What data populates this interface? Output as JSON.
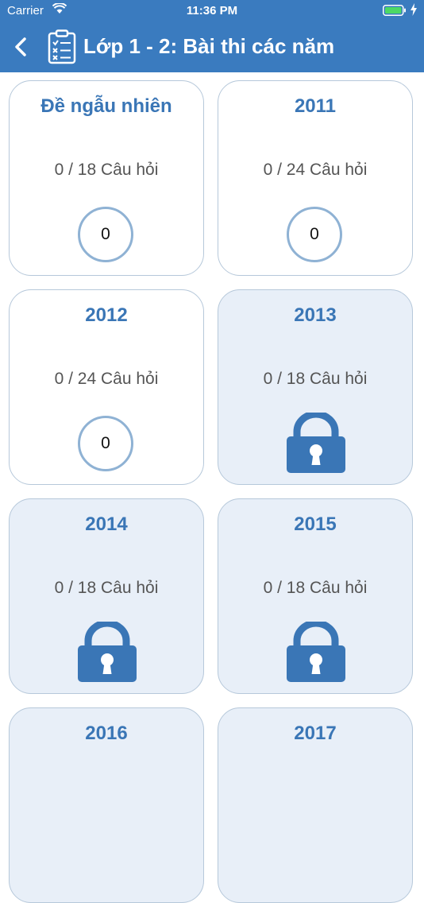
{
  "status_bar": {
    "carrier": "Carrier",
    "time": "11:36 PM"
  },
  "header": {
    "title": "Lớp 1 - 2: Bài thi các năm"
  },
  "colors": {
    "header": "#3a7bbf",
    "accent": "#3a76b6",
    "locked_bg": "#e8eff8"
  },
  "cards": [
    {
      "title": "Đề ngẫu nhiên",
      "count": "0 / 18 Câu hỏi",
      "score": "0",
      "locked": false
    },
    {
      "title": "2011",
      "count": "0 / 24 Câu hỏi",
      "score": "0",
      "locked": false
    },
    {
      "title": "2012",
      "count": "0 / 24 Câu hỏi",
      "score": "0",
      "locked": false
    },
    {
      "title": "2013",
      "count": "0 / 18 Câu hỏi",
      "locked": true,
      "icon": "lock-icon"
    },
    {
      "title": "2014",
      "count": "0 / 18 Câu hỏi",
      "locked": true,
      "icon": "lock-icon"
    },
    {
      "title": "2015",
      "count": "0 / 18 Câu hỏi",
      "locked": true,
      "icon": "lock-icon"
    },
    {
      "title": "2016",
      "locked": true
    },
    {
      "title": "2017",
      "locked": true
    }
  ]
}
